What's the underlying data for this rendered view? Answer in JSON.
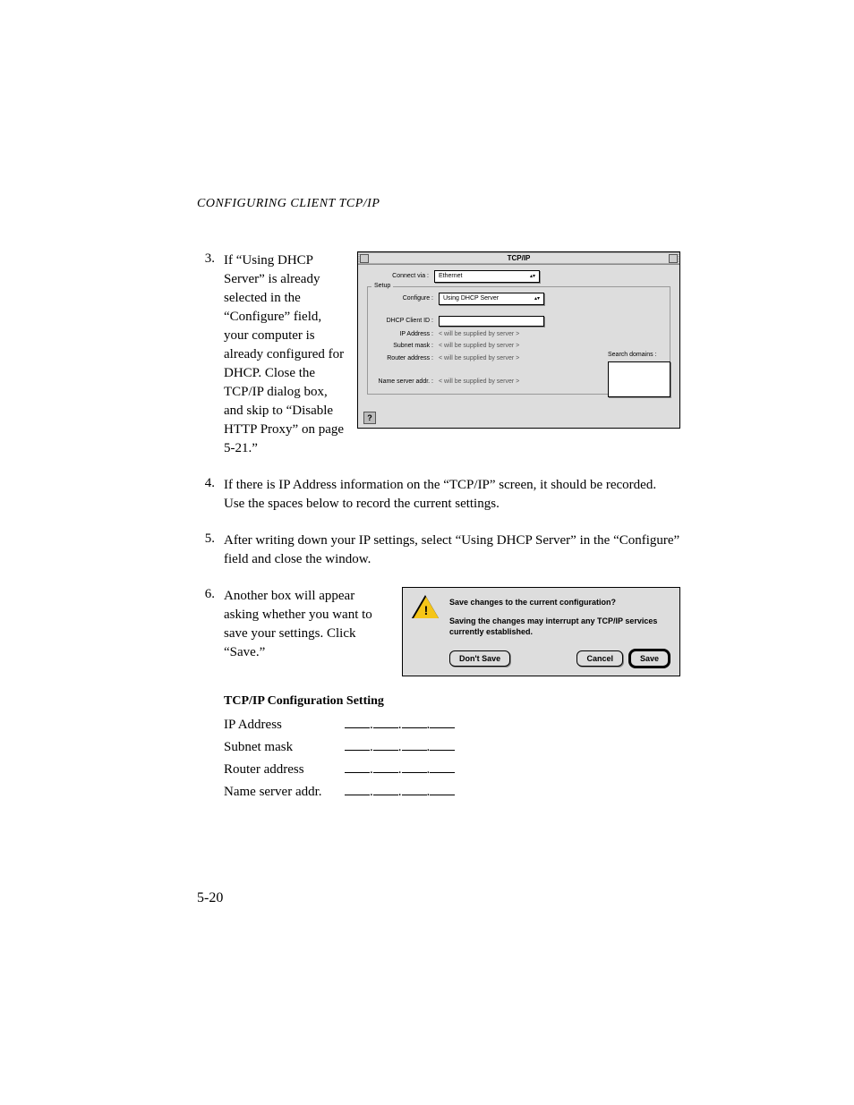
{
  "header": "CONFIGURING CLIENT TCP/IP",
  "steps": {
    "s3": {
      "num": "3.",
      "text": "If “Using DHCP Server” is already selected in the “Configure” field, your computer is already configured for DHCP. Close the TCP/IP dialog box, and skip to “Disable HTTP Proxy” on page 5-21.”"
    },
    "s4": {
      "num": "4.",
      "text": "If there is IP Address information on the “TCP/IP” screen, it should be recorded. Use the spaces below to record the current settings."
    },
    "s5": {
      "num": "5.",
      "text": "After writing down your IP settings, select “Using DHCP Server” in the “Configure” field and close the window."
    },
    "s6": {
      "num": "6.",
      "text": "Another box will appear asking whether you want to save your settings. Click “Save.”"
    }
  },
  "tcpip": {
    "title": "TCP/IP",
    "connect_via_label": "Connect via :",
    "connect_via_value": "Ethernet",
    "setup_legend": "Setup",
    "configure_label": "Configure :",
    "configure_value": "Using DHCP Server",
    "dhcp_client_label": "DHCP Client ID :",
    "ip_label": "IP Address :",
    "ip_value": "< will be supplied by server >",
    "subnet_label": "Subnet mask :",
    "subnet_value": "< will be supplied by server >",
    "router_label": "Router address :",
    "router_value": "< will be supplied by server >",
    "ns_label": "Name server addr. :",
    "ns_value": "< will be supplied by server >",
    "search_label": "Search domains :",
    "help_glyph": "?"
  },
  "save_dialog": {
    "question": "Save changes to the current configuration?",
    "subtext": "Saving the changes may interrupt any TCP/IP services currently established.",
    "dont_save": "Don't Save",
    "cancel": "Cancel",
    "save": "Save",
    "warn_glyph": "!"
  },
  "config_section": {
    "heading": "TCP/IP Configuration Setting",
    "rows": {
      "ip": "IP Address",
      "subnet": "Subnet mask",
      "router": "Router address",
      "ns": "Name server addr."
    },
    "dot": "."
  },
  "page_number": "5-20"
}
